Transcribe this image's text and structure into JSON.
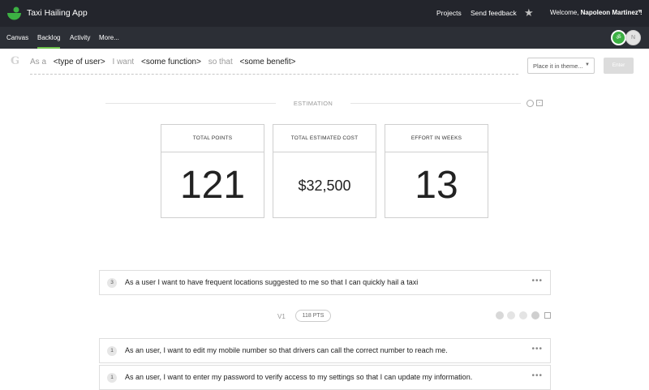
{
  "app": {
    "title": "Taxi Hailing App"
  },
  "topnav": {
    "projects": "Projects",
    "feedback": "Send feedback",
    "welcome_prefix": "Welcome,",
    "user_name": "Napoleon Martinez !"
  },
  "tabs": [
    "Canvas",
    "Backlog",
    "Activity",
    "More..."
  ],
  "active_tab": "Backlog",
  "avatars": {
    "green": "ॐ",
    "grey": "N"
  },
  "story_input": {
    "as_a": "As a",
    "type_placeholder": "<type of user>",
    "i_want": "I want",
    "function_placeholder": "<some function>",
    "so_that": "so that",
    "benefit_placeholder": "<some benefit>",
    "theme_select": "Place it in theme...",
    "enter_label": "Enter"
  },
  "estimation": {
    "label": "ESTIMATION",
    "cards": [
      {
        "title": "TOTAL POINTS",
        "value": "121"
      },
      {
        "title": "TOTAL ESTIMATED COST",
        "value": "$32,500"
      },
      {
        "title": "EFFORT IN WEEKS",
        "value": "13"
      }
    ]
  },
  "stories": [
    {
      "points": "3",
      "text": "As a user I want to have frequent locations suggested to me so that I can quickly hail a taxi"
    },
    {
      "points": "1",
      "text": "As an user, I want to edit my mobile number so that drivers can call the correct number to reach me."
    },
    {
      "points": "1",
      "text": "As an user, I want to enter my password to verify access to my settings so that I can update my information."
    }
  ],
  "version": {
    "name": "V1",
    "points": "118 PTS"
  },
  "colors": {
    "accent": "#6cc04a",
    "topbar": "#23252c",
    "subbar": "#2c2f36"
  }
}
